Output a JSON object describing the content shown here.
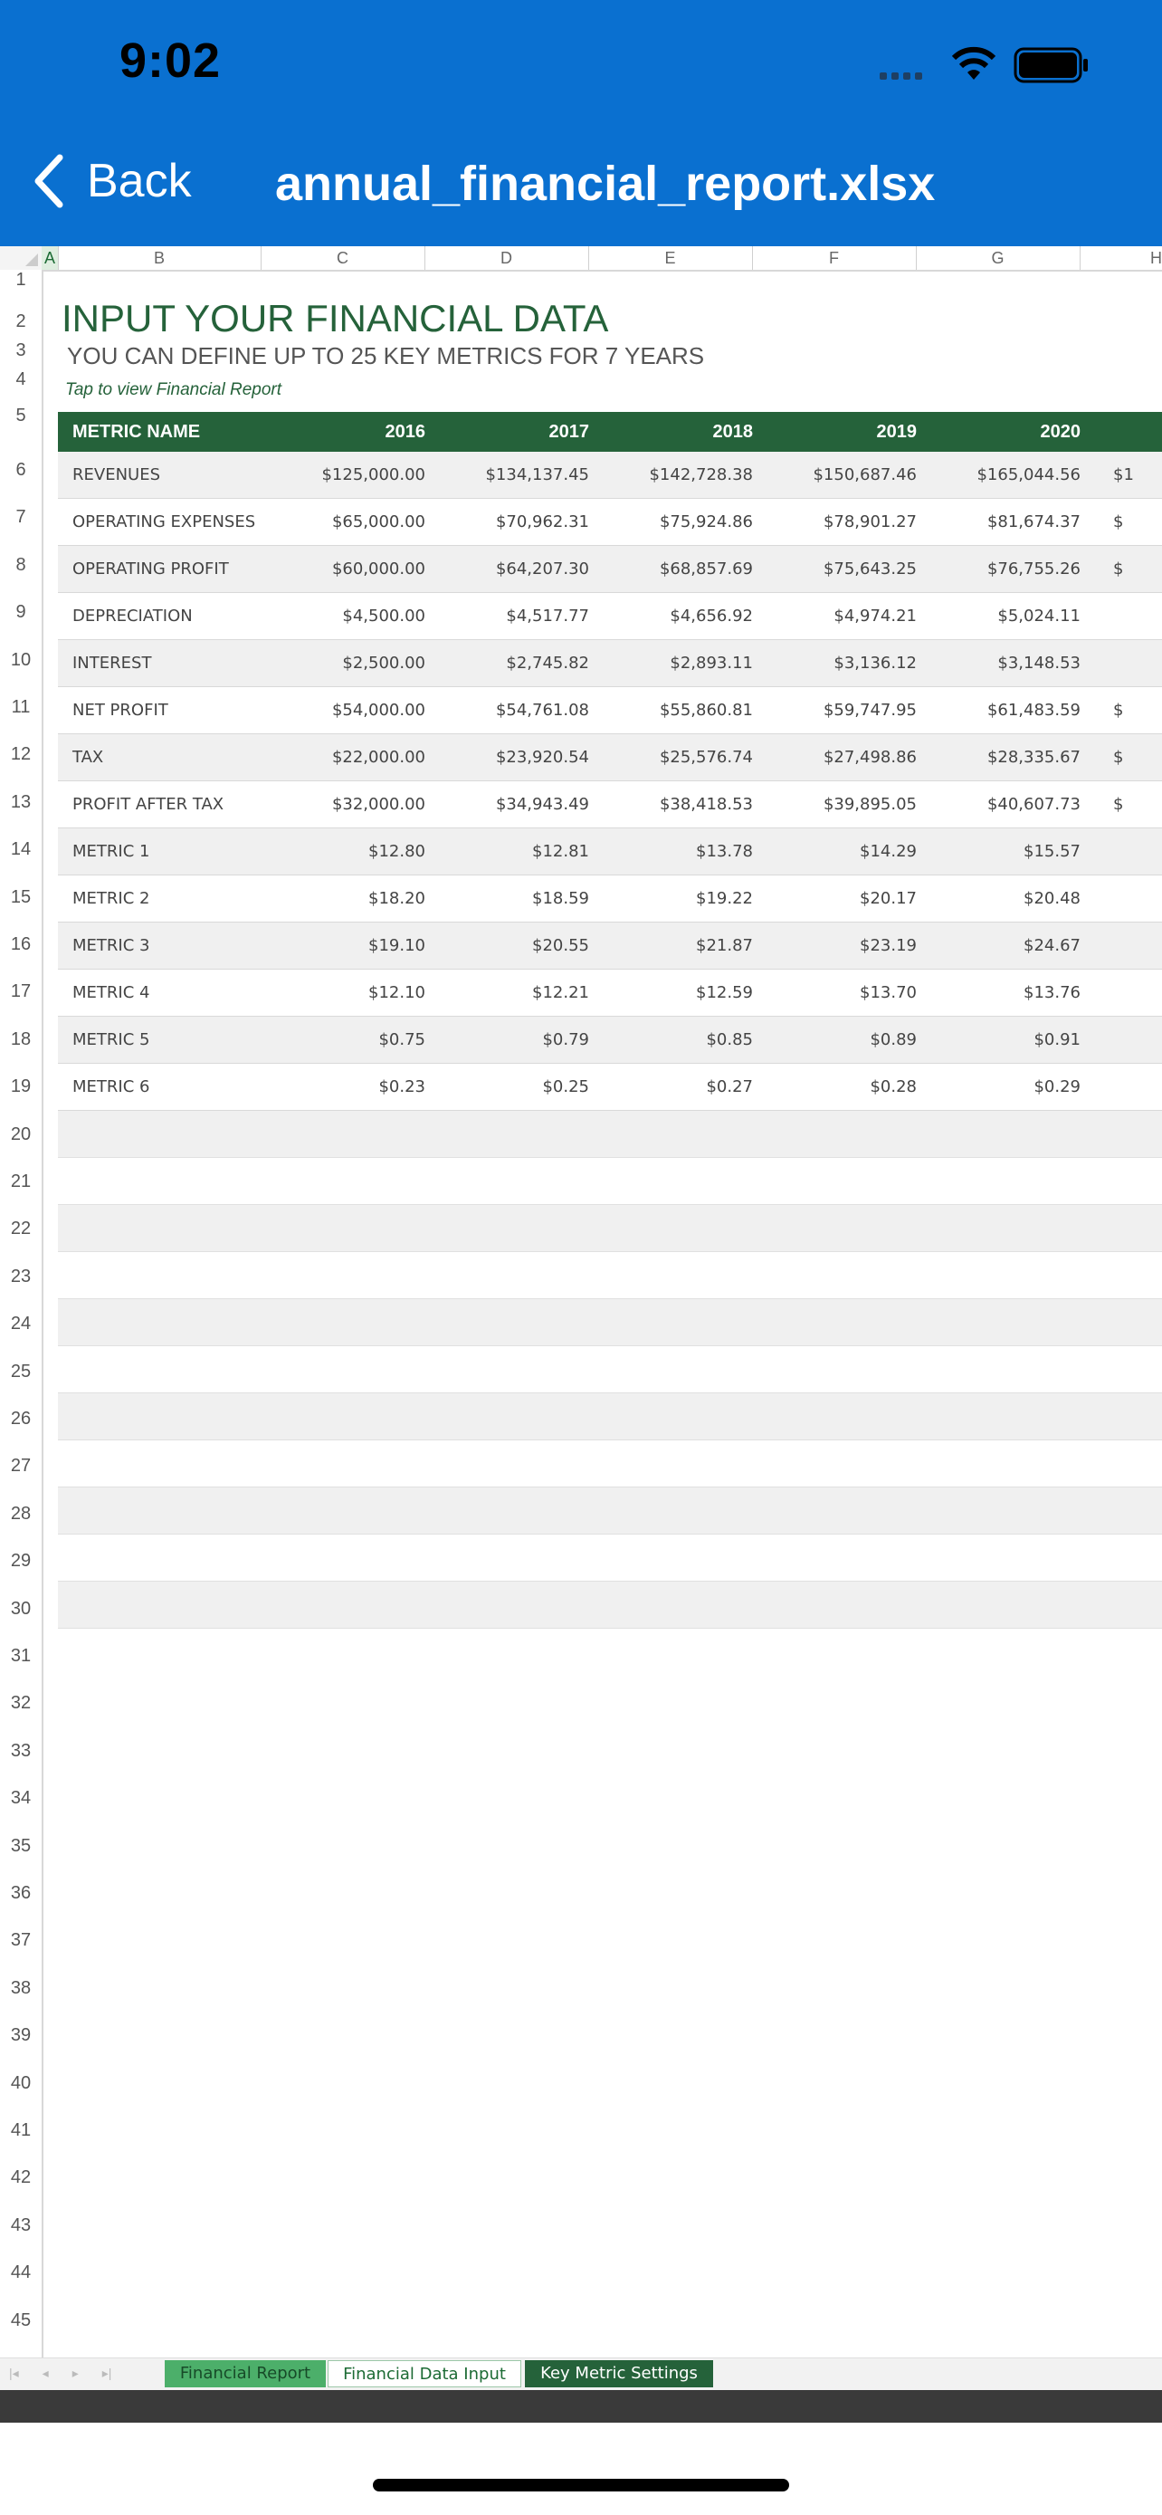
{
  "status": {
    "time": "9:02"
  },
  "nav": {
    "back_label": "Back",
    "title": "annual_financial_report.xlsx"
  },
  "columns": [
    "A",
    "B",
    "C",
    "D",
    "E",
    "F",
    "G",
    "H"
  ],
  "row_numbers": [
    "1",
    "2",
    "3",
    "4",
    "5",
    "6",
    "7",
    "8",
    "9",
    "10",
    "11",
    "12",
    "13",
    "14",
    "15",
    "16",
    "17",
    "18",
    "19",
    "20",
    "21",
    "22",
    "23",
    "24",
    "25",
    "26",
    "27",
    "28",
    "29",
    "30",
    "31",
    "32",
    "33",
    "34",
    "35",
    "36",
    "37",
    "38",
    "39",
    "40",
    "41",
    "42",
    "43",
    "44",
    "45"
  ],
  "sheet": {
    "heading": "INPUT YOUR FINANCIAL DATA",
    "subheading": "YOU CAN DEFINE UP TO 25 KEY METRICS FOR 7 YEARS",
    "link": "Tap to view Financial Report",
    "header": {
      "name": "METRIC NAME",
      "years": [
        "2016",
        "2017",
        "2018",
        "2019",
        "2020"
      ]
    },
    "rows": [
      {
        "name": "REVENUES",
        "values": [
          "$125,000.00",
          "$134,137.45",
          "$142,728.38",
          "$150,687.46",
          "$165,044.56"
        ],
        "clip": "$1"
      },
      {
        "name": "OPERATING EXPENSES",
        "values": [
          "$65,000.00",
          "$70,962.31",
          "$75,924.86",
          "$78,901.27",
          "$81,674.37"
        ],
        "clip": "$"
      },
      {
        "name": "OPERATING PROFIT",
        "values": [
          "$60,000.00",
          "$64,207.30",
          "$68,857.69",
          "$75,643.25",
          "$76,755.26"
        ],
        "clip": "$"
      },
      {
        "name": "DEPRECIATION",
        "values": [
          "$4,500.00",
          "$4,517.77",
          "$4,656.92",
          "$4,974.21",
          "$5,024.11"
        ],
        "clip": ""
      },
      {
        "name": "INTEREST",
        "values": [
          "$2,500.00",
          "$2,745.82",
          "$2,893.11",
          "$3,136.12",
          "$3,148.53"
        ],
        "clip": ""
      },
      {
        "name": "NET PROFIT",
        "values": [
          "$54,000.00",
          "$54,761.08",
          "$55,860.81",
          "$59,747.95",
          "$61,483.59"
        ],
        "clip": "$"
      },
      {
        "name": "TAX",
        "values": [
          "$22,000.00",
          "$23,920.54",
          "$25,576.74",
          "$27,498.86",
          "$28,335.67"
        ],
        "clip": "$"
      },
      {
        "name": "PROFIT AFTER TAX",
        "values": [
          "$32,000.00",
          "$34,943.49",
          "$38,418.53",
          "$39,895.05",
          "$40,607.73"
        ],
        "clip": "$"
      },
      {
        "name": "METRIC 1",
        "values": [
          "$12.80",
          "$12.81",
          "$13.78",
          "$14.29",
          "$15.57"
        ],
        "clip": ""
      },
      {
        "name": "METRIC 2",
        "values": [
          "$18.20",
          "$18.59",
          "$19.22",
          "$20.17",
          "$20.48"
        ],
        "clip": ""
      },
      {
        "name": "METRIC 3",
        "values": [
          "$19.10",
          "$20.55",
          "$21.87",
          "$23.19",
          "$24.67"
        ],
        "clip": ""
      },
      {
        "name": "METRIC 4",
        "values": [
          "$12.10",
          "$12.21",
          "$12.59",
          "$13.70",
          "$13.76"
        ],
        "clip": ""
      },
      {
        "name": "METRIC 5",
        "values": [
          "$0.75",
          "$0.79",
          "$0.85",
          "$0.89",
          "$0.91"
        ],
        "clip": ""
      },
      {
        "name": "METRIC 6",
        "values": [
          "$0.23",
          "$0.25",
          "$0.27",
          "$0.28",
          "$0.29"
        ],
        "clip": ""
      }
    ]
  },
  "tabs": [
    {
      "label": "Financial Report"
    },
    {
      "label": "Financial Data Input"
    },
    {
      "label": "Key Metric Settings"
    }
  ],
  "colors": {
    "accent_blue": "#0a70d0",
    "sheet_green": "#25623a",
    "tab_green": "#4caf6a"
  }
}
